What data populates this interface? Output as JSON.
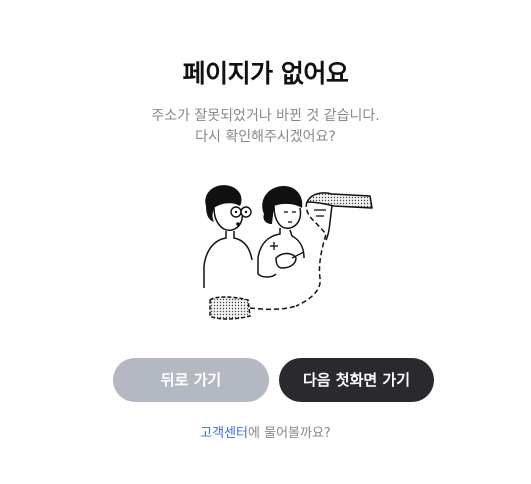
{
  "title": "페이지가 없어요",
  "message": {
    "line1": "주소가 잘못되었거나 바뀐 것 같습니다.",
    "line2": "다시 확인해주시겠어요?"
  },
  "illustration_icon": "two-people-reading-scroll-illustration",
  "buttons": {
    "back_label": "뒤로 가기",
    "home_label": "다음 첫화면 가기"
  },
  "help": {
    "link_text": "고객센터",
    "suffix_text": "에 물어볼까요?"
  },
  "colors": {
    "back_button_bg": "#b3b8c2",
    "home_button_bg": "#2a2a2e",
    "link": "#3a6fd8",
    "muted_text": "#888888"
  }
}
